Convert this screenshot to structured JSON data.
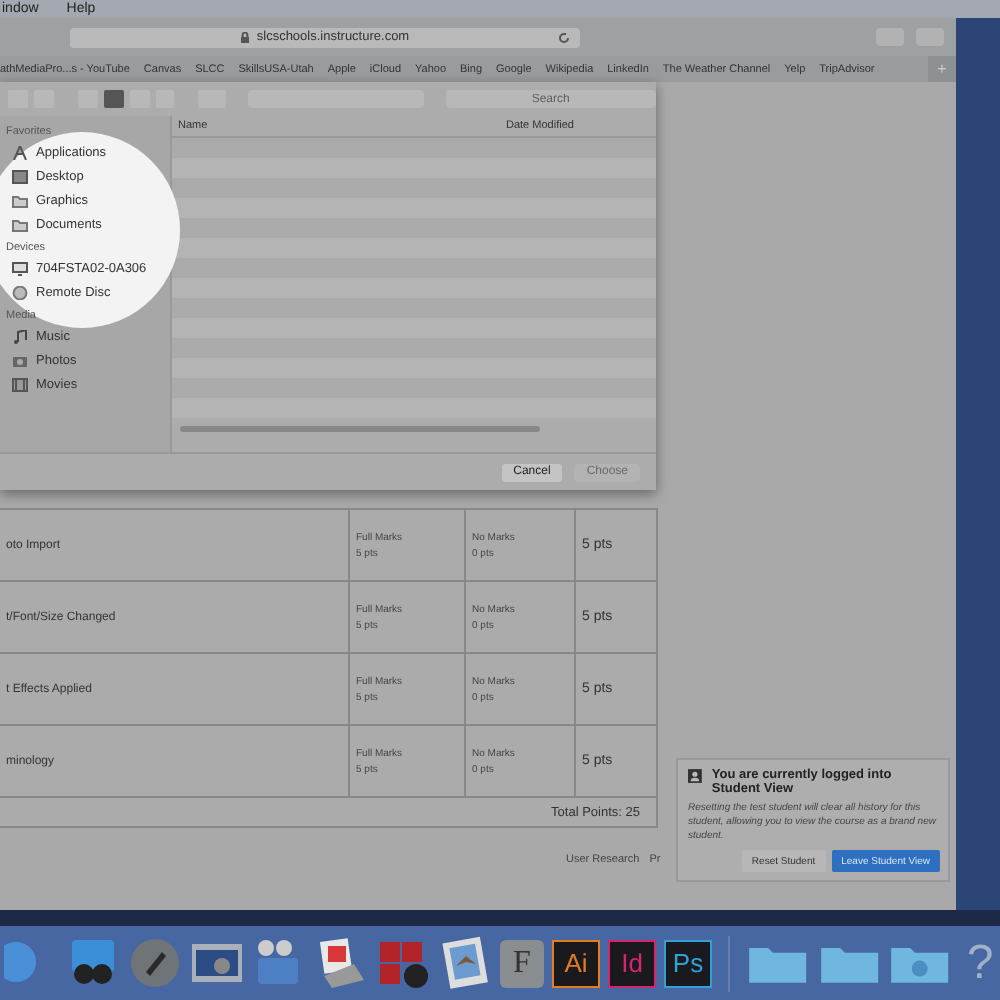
{
  "menu_bar": [
    "indow",
    "Help"
  ],
  "browser": {
    "url": "slcschools.instructure.com",
    "bookmarks": [
      "athMediaPro...s - YouTube",
      "Canvas",
      "SLCC",
      "SkillsUSA-Utah",
      "Apple",
      "iCloud",
      "Yahoo",
      "Bing",
      "Google",
      "Wikipedia",
      "LinkedIn",
      "The Weather Channel",
      "Yelp",
      "TripAdvisor"
    ],
    "new_tab": "+"
  },
  "dialog": {
    "search": {
      "placeholder": "Search"
    },
    "sidebar": [
      {
        "heading": "Favorites",
        "items": [
          {
            "label": "Applications",
            "kind": "apps"
          },
          {
            "label": "Desktop",
            "kind": "desktop"
          },
          {
            "label": "Graphics",
            "kind": "folder"
          },
          {
            "label": "Documents",
            "kind": "folder"
          }
        ]
      },
      {
        "heading": "Devices",
        "items": [
          {
            "label": "704FSTA02-0A306",
            "kind": "computer"
          },
          {
            "label": "Remote Disc",
            "kind": "disc"
          }
        ]
      },
      {
        "heading": "Media",
        "items": [
          {
            "label": "Music",
            "kind": "music"
          },
          {
            "label": "Photos",
            "kind": "camera"
          },
          {
            "label": "Movies",
            "kind": "film"
          }
        ]
      }
    ],
    "columns": [
      "Name",
      "Date Modified"
    ],
    "buttons": [
      {
        "label": "Cancel",
        "disabled": false
      },
      {
        "label": "Choose",
        "disabled": true
      }
    ]
  },
  "rubric": {
    "rows": [
      {
        "criterion": "oto Import",
        "rating_1": [
          "Full Marks",
          "5 pts"
        ],
        "rating_2": [
          "No Marks",
          "0 pts"
        ],
        "points": "5 pts"
      },
      {
        "criterion": "t/Font/Size Changed",
        "rating_1": [
          "Full Marks",
          "5 pts"
        ],
        "rating_2": [
          "No Marks",
          "0 pts"
        ],
        "points": "5 pts"
      },
      {
        "criterion": "t Effects Applied",
        "rating_1": [
          "Full Marks",
          "5 pts"
        ],
        "rating_2": [
          "No Marks",
          "0 pts"
        ],
        "points": "5 pts"
      },
      {
        "criterion": "minology",
        "rating_1": [
          "Full Marks",
          "5 pts"
        ],
        "rating_2": [
          "No Marks",
          "0 pts"
        ],
        "points": "5 pts"
      }
    ],
    "total": "Total Points: 25"
  },
  "footer_links": [
    "User Research",
    "Pr"
  ],
  "toast": {
    "title": "You are currently logged into Student View",
    "message": "Resetting the test student will clear all history for this student, allowing you to view the course as a brand new student.",
    "buttons": [
      {
        "label": "Reset Student",
        "primary": false
      },
      {
        "label": "Leave Student View",
        "primary": true
      }
    ]
  },
  "dock": [
    {
      "kind": "finder"
    },
    {
      "kind": "binoculars"
    },
    {
      "kind": "rocket"
    },
    {
      "kind": "screen"
    },
    {
      "kind": "movie"
    },
    {
      "kind": "preview"
    },
    {
      "kind": "photobooth"
    },
    {
      "kind": "mail"
    },
    {
      "kind": "font",
      "text": "F"
    },
    {
      "kind": "app",
      "text": "Ai",
      "color": "#e37b1f"
    },
    {
      "kind": "app",
      "text": "Id",
      "color": "#d4266f"
    },
    {
      "kind": "app",
      "text": "Ps",
      "color": "#2fa2d8"
    },
    {
      "kind": "divider"
    },
    {
      "kind": "folder"
    },
    {
      "kind": "folder"
    },
    {
      "kind": "downloads"
    },
    {
      "kind": "help",
      "text": "?"
    }
  ]
}
